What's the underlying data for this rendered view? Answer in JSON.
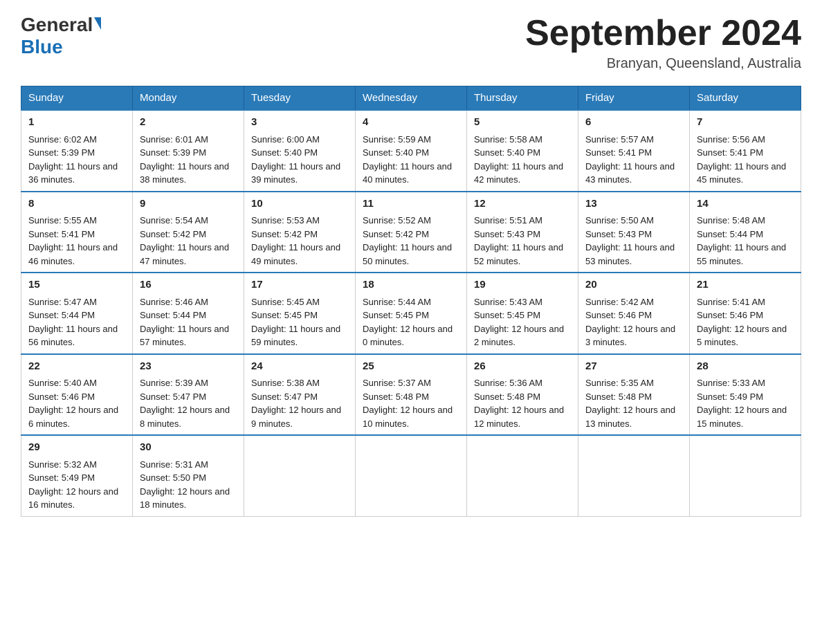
{
  "logo": {
    "general": "General",
    "blue": "Blue"
  },
  "title": "September 2024",
  "location": "Branyan, Queensland, Australia",
  "headers": [
    "Sunday",
    "Monday",
    "Tuesday",
    "Wednesday",
    "Thursday",
    "Friday",
    "Saturday"
  ],
  "weeks": [
    [
      {
        "day": "1",
        "sunrise": "Sunrise: 6:02 AM",
        "sunset": "Sunset: 5:39 PM",
        "daylight": "Daylight: 11 hours and 36 minutes."
      },
      {
        "day": "2",
        "sunrise": "Sunrise: 6:01 AM",
        "sunset": "Sunset: 5:39 PM",
        "daylight": "Daylight: 11 hours and 38 minutes."
      },
      {
        "day": "3",
        "sunrise": "Sunrise: 6:00 AM",
        "sunset": "Sunset: 5:40 PM",
        "daylight": "Daylight: 11 hours and 39 minutes."
      },
      {
        "day": "4",
        "sunrise": "Sunrise: 5:59 AM",
        "sunset": "Sunset: 5:40 PM",
        "daylight": "Daylight: 11 hours and 40 minutes."
      },
      {
        "day": "5",
        "sunrise": "Sunrise: 5:58 AM",
        "sunset": "Sunset: 5:40 PM",
        "daylight": "Daylight: 11 hours and 42 minutes."
      },
      {
        "day": "6",
        "sunrise": "Sunrise: 5:57 AM",
        "sunset": "Sunset: 5:41 PM",
        "daylight": "Daylight: 11 hours and 43 minutes."
      },
      {
        "day": "7",
        "sunrise": "Sunrise: 5:56 AM",
        "sunset": "Sunset: 5:41 PM",
        "daylight": "Daylight: 11 hours and 45 minutes."
      }
    ],
    [
      {
        "day": "8",
        "sunrise": "Sunrise: 5:55 AM",
        "sunset": "Sunset: 5:41 PM",
        "daylight": "Daylight: 11 hours and 46 minutes."
      },
      {
        "day": "9",
        "sunrise": "Sunrise: 5:54 AM",
        "sunset": "Sunset: 5:42 PM",
        "daylight": "Daylight: 11 hours and 47 minutes."
      },
      {
        "day": "10",
        "sunrise": "Sunrise: 5:53 AM",
        "sunset": "Sunset: 5:42 PM",
        "daylight": "Daylight: 11 hours and 49 minutes."
      },
      {
        "day": "11",
        "sunrise": "Sunrise: 5:52 AM",
        "sunset": "Sunset: 5:42 PM",
        "daylight": "Daylight: 11 hours and 50 minutes."
      },
      {
        "day": "12",
        "sunrise": "Sunrise: 5:51 AM",
        "sunset": "Sunset: 5:43 PM",
        "daylight": "Daylight: 11 hours and 52 minutes."
      },
      {
        "day": "13",
        "sunrise": "Sunrise: 5:50 AM",
        "sunset": "Sunset: 5:43 PM",
        "daylight": "Daylight: 11 hours and 53 minutes."
      },
      {
        "day": "14",
        "sunrise": "Sunrise: 5:48 AM",
        "sunset": "Sunset: 5:44 PM",
        "daylight": "Daylight: 11 hours and 55 minutes."
      }
    ],
    [
      {
        "day": "15",
        "sunrise": "Sunrise: 5:47 AM",
        "sunset": "Sunset: 5:44 PM",
        "daylight": "Daylight: 11 hours and 56 minutes."
      },
      {
        "day": "16",
        "sunrise": "Sunrise: 5:46 AM",
        "sunset": "Sunset: 5:44 PM",
        "daylight": "Daylight: 11 hours and 57 minutes."
      },
      {
        "day": "17",
        "sunrise": "Sunrise: 5:45 AM",
        "sunset": "Sunset: 5:45 PM",
        "daylight": "Daylight: 11 hours and 59 minutes."
      },
      {
        "day": "18",
        "sunrise": "Sunrise: 5:44 AM",
        "sunset": "Sunset: 5:45 PM",
        "daylight": "Daylight: 12 hours and 0 minutes."
      },
      {
        "day": "19",
        "sunrise": "Sunrise: 5:43 AM",
        "sunset": "Sunset: 5:45 PM",
        "daylight": "Daylight: 12 hours and 2 minutes."
      },
      {
        "day": "20",
        "sunrise": "Sunrise: 5:42 AM",
        "sunset": "Sunset: 5:46 PM",
        "daylight": "Daylight: 12 hours and 3 minutes."
      },
      {
        "day": "21",
        "sunrise": "Sunrise: 5:41 AM",
        "sunset": "Sunset: 5:46 PM",
        "daylight": "Daylight: 12 hours and 5 minutes."
      }
    ],
    [
      {
        "day": "22",
        "sunrise": "Sunrise: 5:40 AM",
        "sunset": "Sunset: 5:46 PM",
        "daylight": "Daylight: 12 hours and 6 minutes."
      },
      {
        "day": "23",
        "sunrise": "Sunrise: 5:39 AM",
        "sunset": "Sunset: 5:47 PM",
        "daylight": "Daylight: 12 hours and 8 minutes."
      },
      {
        "day": "24",
        "sunrise": "Sunrise: 5:38 AM",
        "sunset": "Sunset: 5:47 PM",
        "daylight": "Daylight: 12 hours and 9 minutes."
      },
      {
        "day": "25",
        "sunrise": "Sunrise: 5:37 AM",
        "sunset": "Sunset: 5:48 PM",
        "daylight": "Daylight: 12 hours and 10 minutes."
      },
      {
        "day": "26",
        "sunrise": "Sunrise: 5:36 AM",
        "sunset": "Sunset: 5:48 PM",
        "daylight": "Daylight: 12 hours and 12 minutes."
      },
      {
        "day": "27",
        "sunrise": "Sunrise: 5:35 AM",
        "sunset": "Sunset: 5:48 PM",
        "daylight": "Daylight: 12 hours and 13 minutes."
      },
      {
        "day": "28",
        "sunrise": "Sunrise: 5:33 AM",
        "sunset": "Sunset: 5:49 PM",
        "daylight": "Daylight: 12 hours and 15 minutes."
      }
    ],
    [
      {
        "day": "29",
        "sunrise": "Sunrise: 5:32 AM",
        "sunset": "Sunset: 5:49 PM",
        "daylight": "Daylight: 12 hours and 16 minutes."
      },
      {
        "day": "30",
        "sunrise": "Sunrise: 5:31 AM",
        "sunset": "Sunset: 5:50 PM",
        "daylight": "Daylight: 12 hours and 18 minutes."
      },
      null,
      null,
      null,
      null,
      null
    ]
  ]
}
